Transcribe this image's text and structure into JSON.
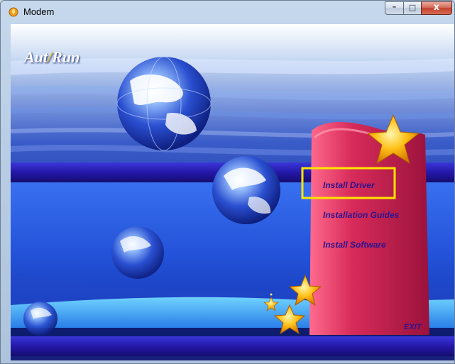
{
  "window": {
    "title": "Modem",
    "min_glyph": "–",
    "max_glyph": "□",
    "close_glyph": "x"
  },
  "autorun": {
    "logo_left": "Aut",
    "logo_slash": "/",
    "logo_right": "Run",
    "menu": {
      "install_driver": "Install Driver",
      "installation_guides": "Installation Guides",
      "install_software": "Install Software",
      "exit": "EXIT"
    },
    "highlight_color": "#ffe400",
    "panel_color": "#c0224f",
    "menu_text_color": "#2c1390"
  }
}
